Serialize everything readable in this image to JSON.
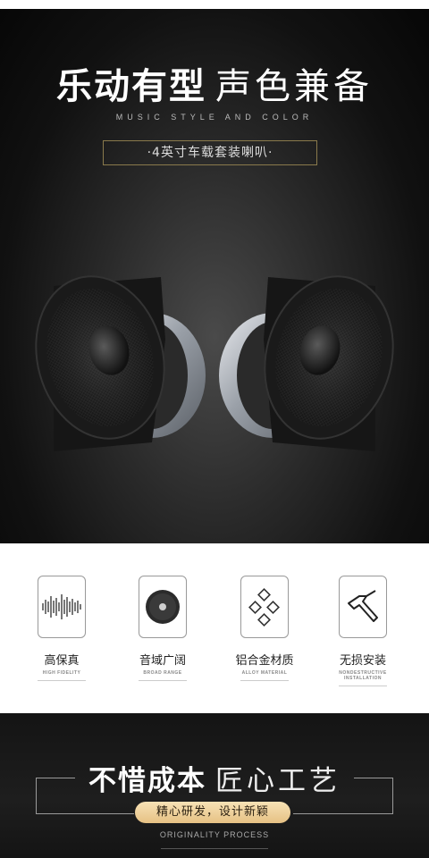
{
  "hero": {
    "title_bold": "乐动有型",
    "title_light": "声色兼备",
    "subtitle_en": "MUSIC STYLE AND COLOR",
    "product_label": "·4英寸车载套装喇叭·"
  },
  "features": [
    {
      "label": "高保真",
      "sub": "HIGH FIDELITY",
      "icon": "waveform-icon"
    },
    {
      "label": "音域广阔",
      "sub": "BROAD RANGE",
      "icon": "speaker-circle-icon"
    },
    {
      "label": "铝合金材质",
      "sub": "ALLOY MATERIAL",
      "icon": "diamond-grid-icon"
    },
    {
      "label": "无损安装",
      "sub": "NONDESTRUCTIVE INSTALLATION",
      "icon": "hammer-icon"
    }
  ],
  "bottom": {
    "title_bold": "不惜成本",
    "title_light": "匠心工艺",
    "pill": "精心研发，设计新颖",
    "origin": "ORIGINALITY PROCESS"
  },
  "colors": {
    "gold_frame": "#8a7a4c",
    "pill_gold": "#e6c184",
    "dark_bg": "#141414"
  }
}
